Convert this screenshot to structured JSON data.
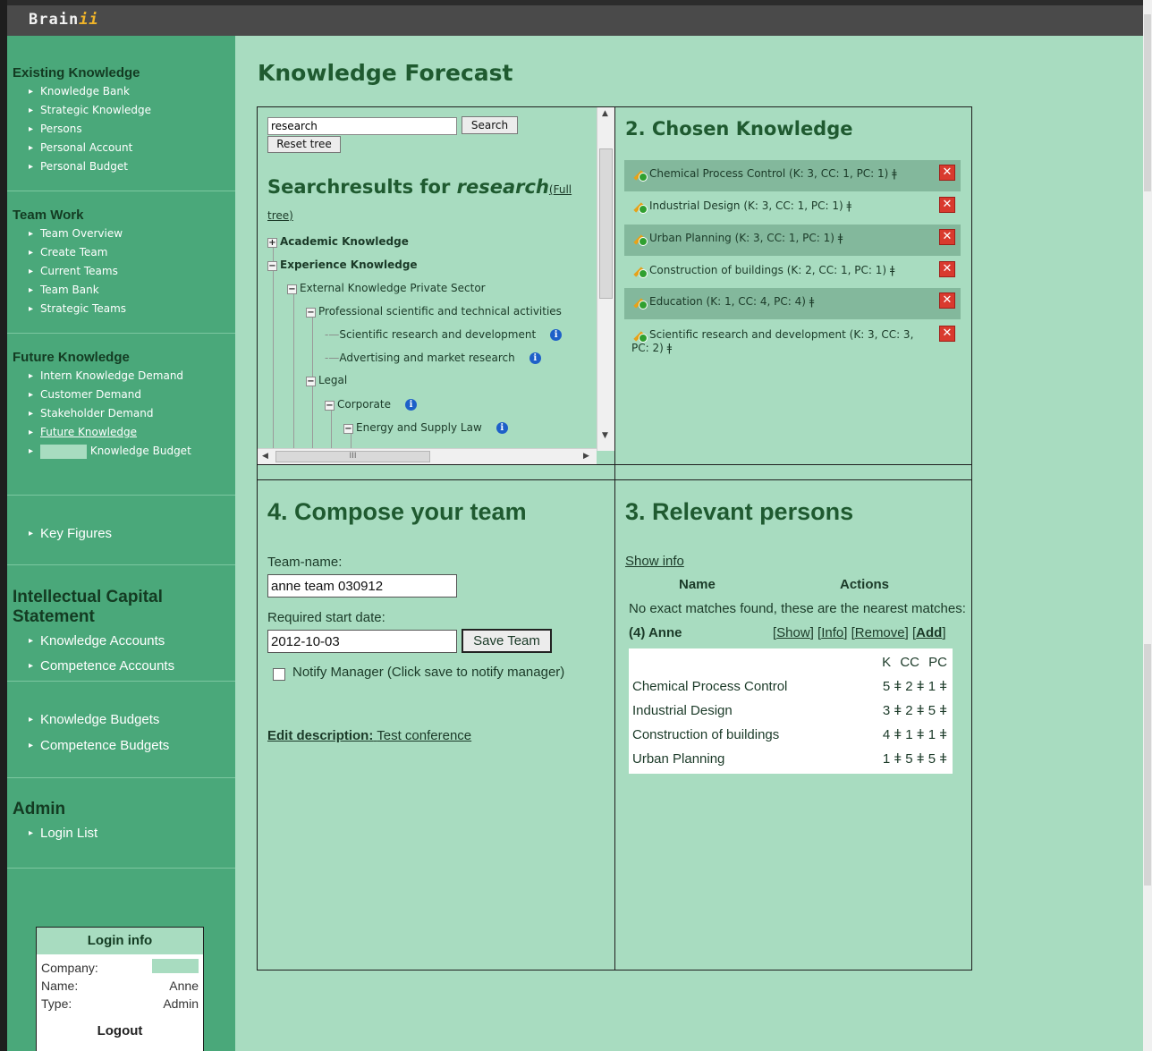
{
  "app": {
    "logo_main": "Brain",
    "logo_accent": "ii"
  },
  "sidebar": {
    "sections": [
      {
        "title": "Existing Knowledge",
        "items": [
          "Knowledge Bank",
          "Strategic Knowledge",
          "Persons",
          "Personal Account",
          "Personal Budget"
        ]
      },
      {
        "title": "Team Work",
        "items": [
          "Team Overview",
          "Create Team",
          "Current Teams",
          "Team Bank",
          "Strategic Teams"
        ]
      },
      {
        "title": "Future Knowledge",
        "items": [
          "Intern Knowledge Demand",
          "Customer Demand",
          "Stakeholder Demand",
          "Future Knowledge",
          "Knowledge Budget"
        ]
      },
      {
        "title": "",
        "items": [
          "Key Figures"
        ]
      },
      {
        "title": "Intellectual Capital Statement",
        "items": [
          "Knowledge Accounts",
          "Competence Accounts"
        ]
      },
      {
        "title": "",
        "items": [
          "Knowledge Budgets",
          "Competence Budgets"
        ]
      },
      {
        "title": "Admin",
        "items": [
          "Login List"
        ]
      }
    ]
  },
  "login": {
    "title": "Login info",
    "company_label": "Company:",
    "name_label": "Name:",
    "name_value": "Anne",
    "type_label": "Type:",
    "type_value": "Admin",
    "logout": "Logout"
  },
  "main": {
    "title": "Knowledge Forecast"
  },
  "tree_panel": {
    "search_value": "research",
    "search_button": "Search",
    "reset_button": "Reset tree",
    "results_prefix": "Searchresults for ",
    "results_keyword": "research",
    "full_tree_open": "(",
    "full_tree_link": "Full tree",
    "full_tree_close": ")",
    "nodes": [
      "Academic Knowledge",
      "Experience Knowledge",
      "External Knowledge Private Sector",
      "Professional scientific and technical activities",
      "Scientific research and development",
      "Advertising and market research",
      "Legal",
      "Corporate",
      "Energy and Supply Law"
    ],
    "hscroll_thumb": "III"
  },
  "chosen": {
    "title": "2. Chosen Knowledge",
    "items": [
      "Chemical Process Control (K: 3, CC: 1, PC: 1) ǂ",
      "Industrial Design (K: 3, CC: 1, PC: 1) ǂ",
      "Urban Planning (K: 3, CC: 1, PC: 1) ǂ",
      "Construction of buildings (K: 2, CC: 1, PC: 1) ǂ",
      "Education (K: 1, CC: 4, PC: 4) ǂ",
      "Scientific research and development (K: 3, CC: 3, PC: 2) ǂ"
    ]
  },
  "compose": {
    "title": "4. Compose your team",
    "team_name_label": "Team-name:",
    "team_name_value": "anne team 030912",
    "start_date_label": "Required start date:",
    "start_date_value": "2012-10-03",
    "save_button": "Save Team",
    "notify_label": "Notify Manager (Click save to notify manager)",
    "edit_description_label": "Edit description:",
    "edit_description_value": "Test conference"
  },
  "persons": {
    "title": "3. Relevant persons",
    "show_info": "Show info",
    "col_name": "Name",
    "col_actions": "Actions",
    "no_match": "No exact matches found, these are the nearest matches:",
    "person": "(4) Anne",
    "actions": [
      "Show",
      "Info",
      "Remove",
      "Add"
    ],
    "table_header": "K CC PC",
    "rows": [
      {
        "name": "Chemical Process Control",
        "values": "5 ǂ 2 ǂ 1 ǂ"
      },
      {
        "name": "Industrial Design",
        "values": "3 ǂ 2 ǂ 5 ǂ"
      },
      {
        "name": "Construction of buildings",
        "values": "4 ǂ 1 ǂ 1 ǂ"
      },
      {
        "name": "Urban Planning",
        "values": "1 ǂ 5 ǂ 5 ǂ"
      }
    ]
  }
}
